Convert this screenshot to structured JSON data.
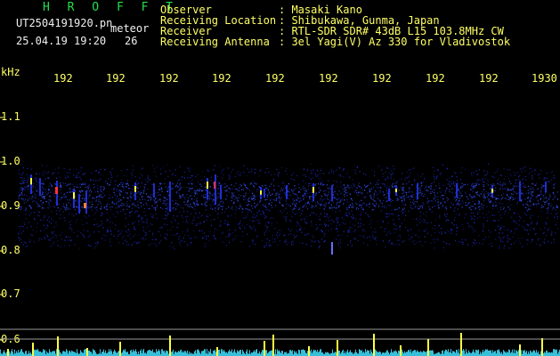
{
  "header": {
    "brand": "H R O F F T",
    "filename": "UT2504191920.pn",
    "mode": "meteor",
    "datetime": "25.04.19 19:20",
    "count": "26",
    "info": [
      {
        "key": "Observer",
        "value": ": Masaki Kano"
      },
      {
        "key": "Receiving Location",
        "value": ": Shibukawa, Gunma, Japan"
      },
      {
        "key": "Receiver",
        "value": ": RTL-SDR SDR# 43dB L15 103.8MHz CW"
      },
      {
        "key": "Receiving Antenna",
        "value": ": 3el Yagi(V) Az 330 for Vladivostok"
      }
    ]
  },
  "axes": {
    "y_unit": "kHz",
    "y_ticks": [
      "1.1",
      "1.0",
      "0.9",
      "0.8",
      "0.7",
      "0.6"
    ],
    "x_ticks": [
      "192",
      "192",
      "192",
      "192",
      "192",
      "192",
      "192",
      "192",
      "192",
      "1930"
    ]
  },
  "colors": {
    "label": "#ffff66",
    "brand": "#22e04a",
    "noise": "#1f2fd0",
    "signal_hot": "#ff3040",
    "signal_warm": "#ffff40",
    "baseline": "#40e0ff"
  }
}
